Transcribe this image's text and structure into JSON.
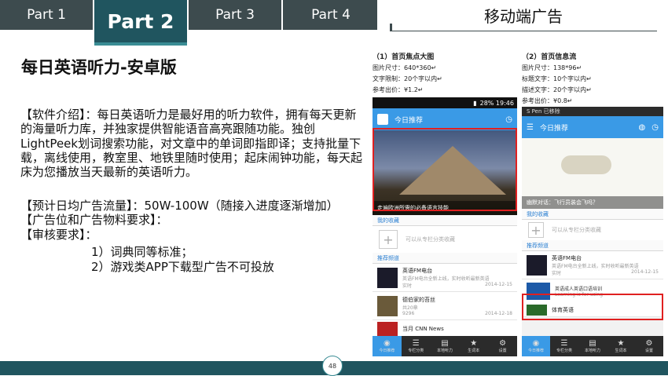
{
  "tabs": [
    {
      "label": "Part 1"
    },
    {
      "label": "Part 2",
      "active": true
    },
    {
      "label": "Part 3"
    },
    {
      "label": "Part 4"
    }
  ],
  "section_title": "移动端广告",
  "heading": "每日英语听力-安卓版",
  "intro": "【软件介绍】：每日英语听力是最好用的听力软件，拥有每天更新的海量听力库，并独家提供智能语音高亮跟随功能。独创LightPeek划词搜索功能，对文章中的单词即指即译；支持批量下载，离线使用，教室里、地铁里随时使用；起床闹钟功能，每天起床为您播放当天最新的英语听力。",
  "traffic": "【预计日均广告流量】：50W-100W（随接入进度逐渐增加）",
  "requirements": "【广告位和广告物料要求】：",
  "review": "【审核要求】：",
  "review_items": [
    "1）词典同等标准；",
    "2）游戏类APP下载型广告不可投放"
  ],
  "caption_left": {
    "title": "（1）首页焦点大图",
    "lines": [
      "图片尺寸：640*360↵",
      "文字限制：20个字以内↵",
      "参考出价：¥1.2↵"
    ]
  },
  "caption_right": {
    "title": "（2）首页信息流",
    "lines": [
      "图片尺寸：138*96↵",
      "标题文字：10个字以内↵",
      "描述文字：20个字以内↵",
      "参考出价：¥0.8↵"
    ]
  },
  "phone_left": {
    "status": "28% 19:46",
    "app_title": "今日推荐",
    "banner_caption": "走遍欧洲所需的必备语言技能",
    "fav_section": "我的收藏",
    "fav_text": "可以从专栏分类收藏",
    "rec_section": "推荐频道",
    "items": [
      {
        "title": "英语FM电台",
        "sub": "英语FM电台全新上线，实时收听最新英语",
        "left": "实时",
        "right": "2014-12-15"
      },
      {
        "title": "德伯家的苔丝",
        "sub": "共20章",
        "left": "9296",
        "right": "2014-12-18"
      },
      {
        "title": "当月 CNN News",
        "sub": "",
        "left": "",
        "right": ""
      }
    ],
    "tabbar": [
      "今日推荐",
      "专栏分类",
      "本地听力",
      "生词本",
      "设置"
    ]
  },
  "phone_right": {
    "spen": "S Pen 已移除",
    "app_title": "今日推荐",
    "banner_caption": "幽默对话：飞行员装会飞吗？",
    "fav_section": "我的收藏",
    "fav_text": "可以从专栏分类收藏",
    "rec_section": "推荐频道",
    "item_fm": {
      "title": "英语FM电台",
      "sub": "英语FM电台全新上线，实时收听最新英语",
      "left": "实时",
      "right": "2014-12-15"
    },
    "ad": {
      "title": "英语成人英语口语培训",
      "sub": "Learning is for using"
    },
    "item_last": "体育英语",
    "tabbar": [
      "今日推荐",
      "专栏分类",
      "本地听力",
      "生词本",
      "设置"
    ]
  },
  "page_number": "48"
}
